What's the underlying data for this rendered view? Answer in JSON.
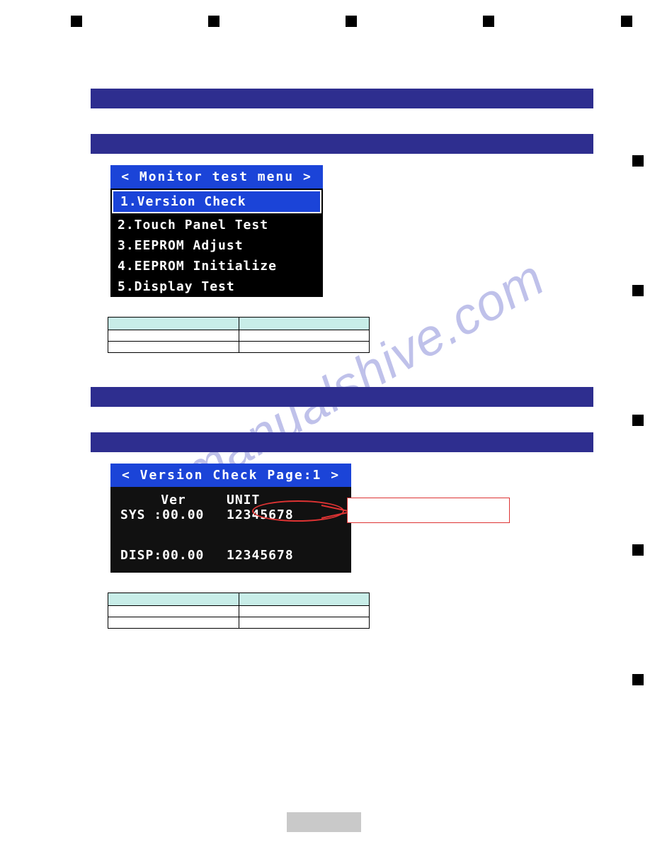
{
  "monitor_menu": {
    "title": "< Monitor test menu >",
    "items": [
      "1.Version Check",
      "2.Touch Panel Test",
      "3.EEPROM Adjust",
      "4.EEPROM Initialize",
      "5.Display Test"
    ],
    "selected_index": 0
  },
  "version_check": {
    "title": "< Version Check  Page:1 >",
    "col_ver": "Ver",
    "col_unit": "UNIT",
    "rows": [
      {
        "label": "SYS :00.00",
        "unit": "12345678"
      },
      {
        "label": "DISP:00.00",
        "unit": "12345678"
      }
    ]
  },
  "watermark_text": "manualshive.com"
}
